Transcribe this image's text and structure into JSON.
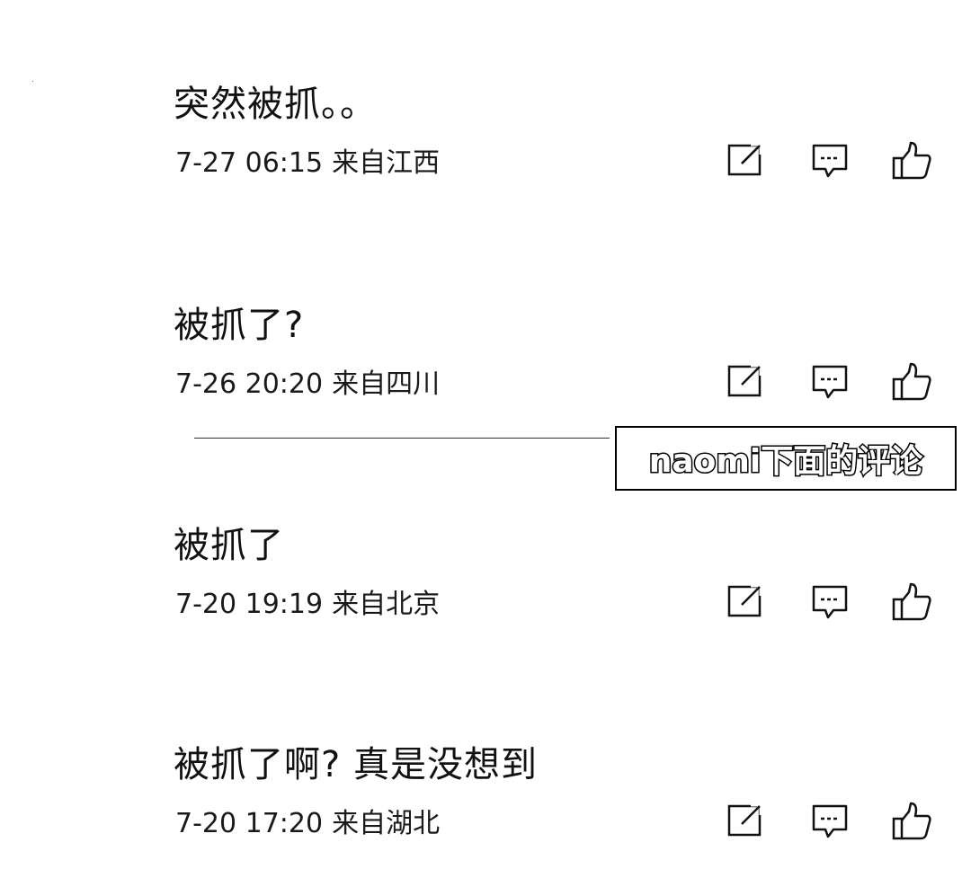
{
  "comments": [
    {
      "text": "突然被抓。。",
      "date": "7-27 06:15",
      "location": "来自江西"
    },
    {
      "text": "被抓了?",
      "date": "7-26 20:20",
      "location": "来自四川"
    },
    {
      "text": "被抓了",
      "date": "7-20 19:19",
      "location": "来自北京"
    },
    {
      "text": "被抓了啊? 真是没想到",
      "date": "7-20 17:20",
      "location": "来自湖北"
    }
  ],
  "caption": "naomi下面的评论",
  "icons": {
    "share": "share-edit-icon",
    "reply": "comment-icon",
    "like": "thumbs-up-icon"
  }
}
